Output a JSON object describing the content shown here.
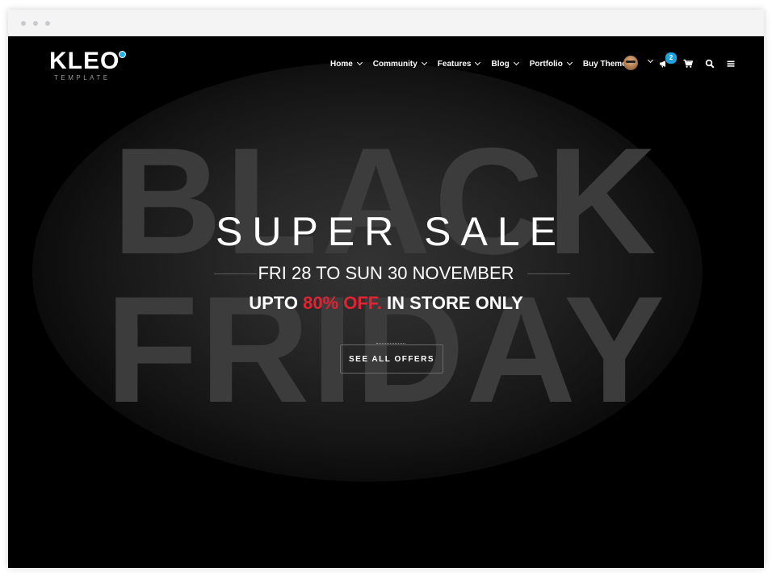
{
  "brand": {
    "name": "KLEO",
    "tagline": "TEMPLATE"
  },
  "nav": {
    "items": [
      {
        "label": "Home",
        "dropdown": true
      },
      {
        "label": "Community",
        "dropdown": true
      },
      {
        "label": "Features",
        "dropdown": true
      },
      {
        "label": "Blog",
        "dropdown": true
      },
      {
        "label": "Portfolio",
        "dropdown": true
      },
      {
        "label": "Buy Theme",
        "dropdown": false
      }
    ],
    "notifications_count": "2",
    "icons": [
      "avatar",
      "chevron-down-icon",
      "megaphone-icon",
      "cart-icon",
      "search-icon",
      "menu-icon"
    ]
  },
  "hero": {
    "background_words": [
      "BLACK",
      "FRIDAY"
    ],
    "headline": "SUPER SALE",
    "date_line": "FRI 28 TO SUN 30 NOVEMBER",
    "offer_prefix": "UPTO",
    "offer_highlight": "80% OFF.",
    "offer_suffix": "IN STORE ONLY",
    "cta_label": "SEE ALL OFFERS"
  },
  "colors": {
    "accent_blue": "#1fa2e0",
    "highlight_red": "#e02433",
    "background": "#000000"
  }
}
